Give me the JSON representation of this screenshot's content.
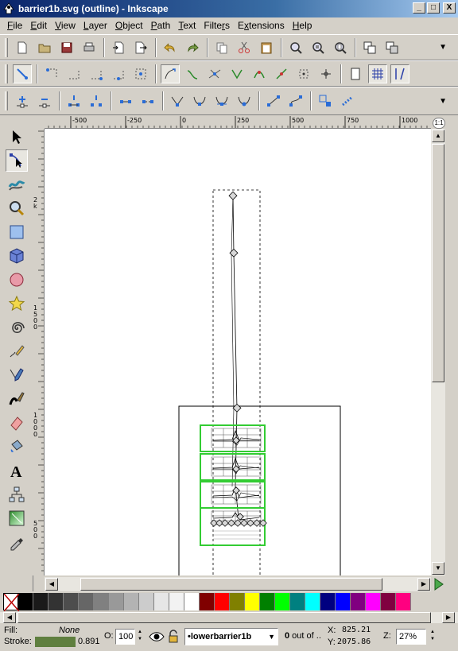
{
  "window": {
    "title": "barrier1b.svg (outline) - Inkscape",
    "buttons": [
      "_",
      "□",
      "X"
    ]
  },
  "menu": [
    {
      "label": "File",
      "mnemonic": "F"
    },
    {
      "label": "Edit",
      "mnemonic": "E"
    },
    {
      "label": "View",
      "mnemonic": "V"
    },
    {
      "label": "Layer",
      "mnemonic": "L"
    },
    {
      "label": "Object",
      "mnemonic": "O"
    },
    {
      "label": "Path",
      "mnemonic": "P"
    },
    {
      "label": "Text",
      "mnemonic": "T"
    },
    {
      "label": "Filters",
      "mnemonic": "r"
    },
    {
      "label": "Extensions",
      "mnemonic": "x"
    },
    {
      "label": "Help",
      "mnemonic": "H"
    }
  ],
  "rulers": {
    "horizontal_labels": [
      "-500",
      "-250",
      "0",
      "250",
      "500",
      "750",
      "1000"
    ],
    "vertical_labels": [
      "2\nk",
      "1\n5\n0\n0",
      "1\n0\n0\n0",
      "5\n0\n0"
    ],
    "zoom_corner": "1:1"
  },
  "colors": {
    "palette": [
      "#000000",
      "#1a1a1a",
      "#333333",
      "#4d4d4d",
      "#666666",
      "#808080",
      "#999999",
      "#b3b3b3",
      "#cccccc",
      "#e6e6e6",
      "#f2f2f2",
      "#ffffff",
      "#800000",
      "#ff0000",
      "#808000",
      "#ffff00",
      "#008000",
      "#00ff00",
      "#008080",
      "#00ffff",
      "#000080",
      "#0000ff",
      "#800080",
      "#ff00ff",
      "#800040",
      "#ff0080"
    ],
    "stroke_swatch": "#5f7f3f",
    "graph_frame": "#33cc33",
    "title_bar": "#0a246a"
  },
  "status": {
    "fill_label": "Fill:",
    "fill_value": "None",
    "stroke_label": "Stroke:",
    "stroke_width": "0.891",
    "opacity_label": "O:",
    "opacity_value": "100",
    "layer": "•lowerbarrier1b",
    "selection_text_bold": "0",
    "selection_text": " out of ..",
    "x_label": "X:",
    "x_value": "825.21",
    "y_label": "Y:",
    "y_value": "2075.86",
    "zoom_label": "Z:",
    "zoom_value": "27%"
  }
}
